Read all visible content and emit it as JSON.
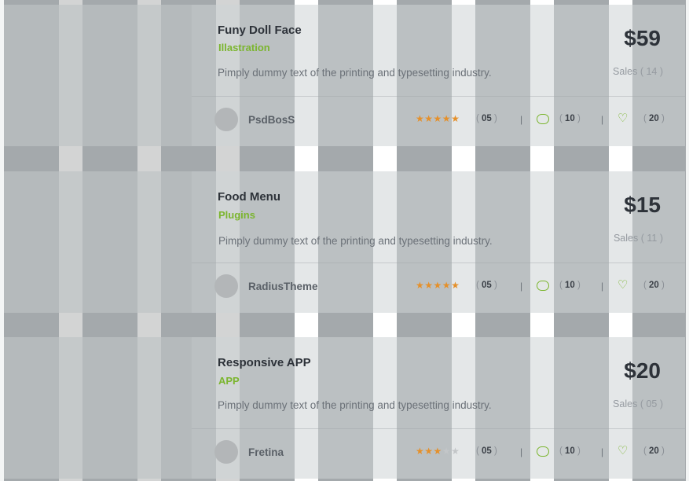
{
  "colors": {
    "accent": "#7bb52e",
    "star": "#e5902a",
    "title": "#2d3239"
  },
  "icons": {
    "comment": "comment-icon",
    "like": "heart-icon",
    "rating": "star-icon"
  },
  "products": [
    {
      "title": "Funy Doll Face",
      "category": "Illastration",
      "description": "Pimply dummy text of the printing and typesetting industry.",
      "price": "$59",
      "sales_label": "Sales",
      "sales": "14",
      "author": "PsdBosS",
      "rating": 5,
      "rating_count": "05",
      "comments": "10",
      "likes": "20"
    },
    {
      "title": "Food Menu",
      "category": "Plugins",
      "description": "Pimply dummy text of the printing and typesetting industry.",
      "price": "$15",
      "sales_label": "Sales",
      "sales": "11",
      "author": "RadiusTheme",
      "rating": 5,
      "rating_count": "05",
      "comments": "10",
      "likes": "20"
    },
    {
      "title": "Responsive APP",
      "category": "APP",
      "description": "Pimply dummy text of the printing and typesetting industry.",
      "price": "$20",
      "sales_label": "Sales",
      "sales": "05",
      "author": "Fretina",
      "rating": 3,
      "rating_count": "05",
      "comments": "10",
      "likes": "20"
    }
  ]
}
